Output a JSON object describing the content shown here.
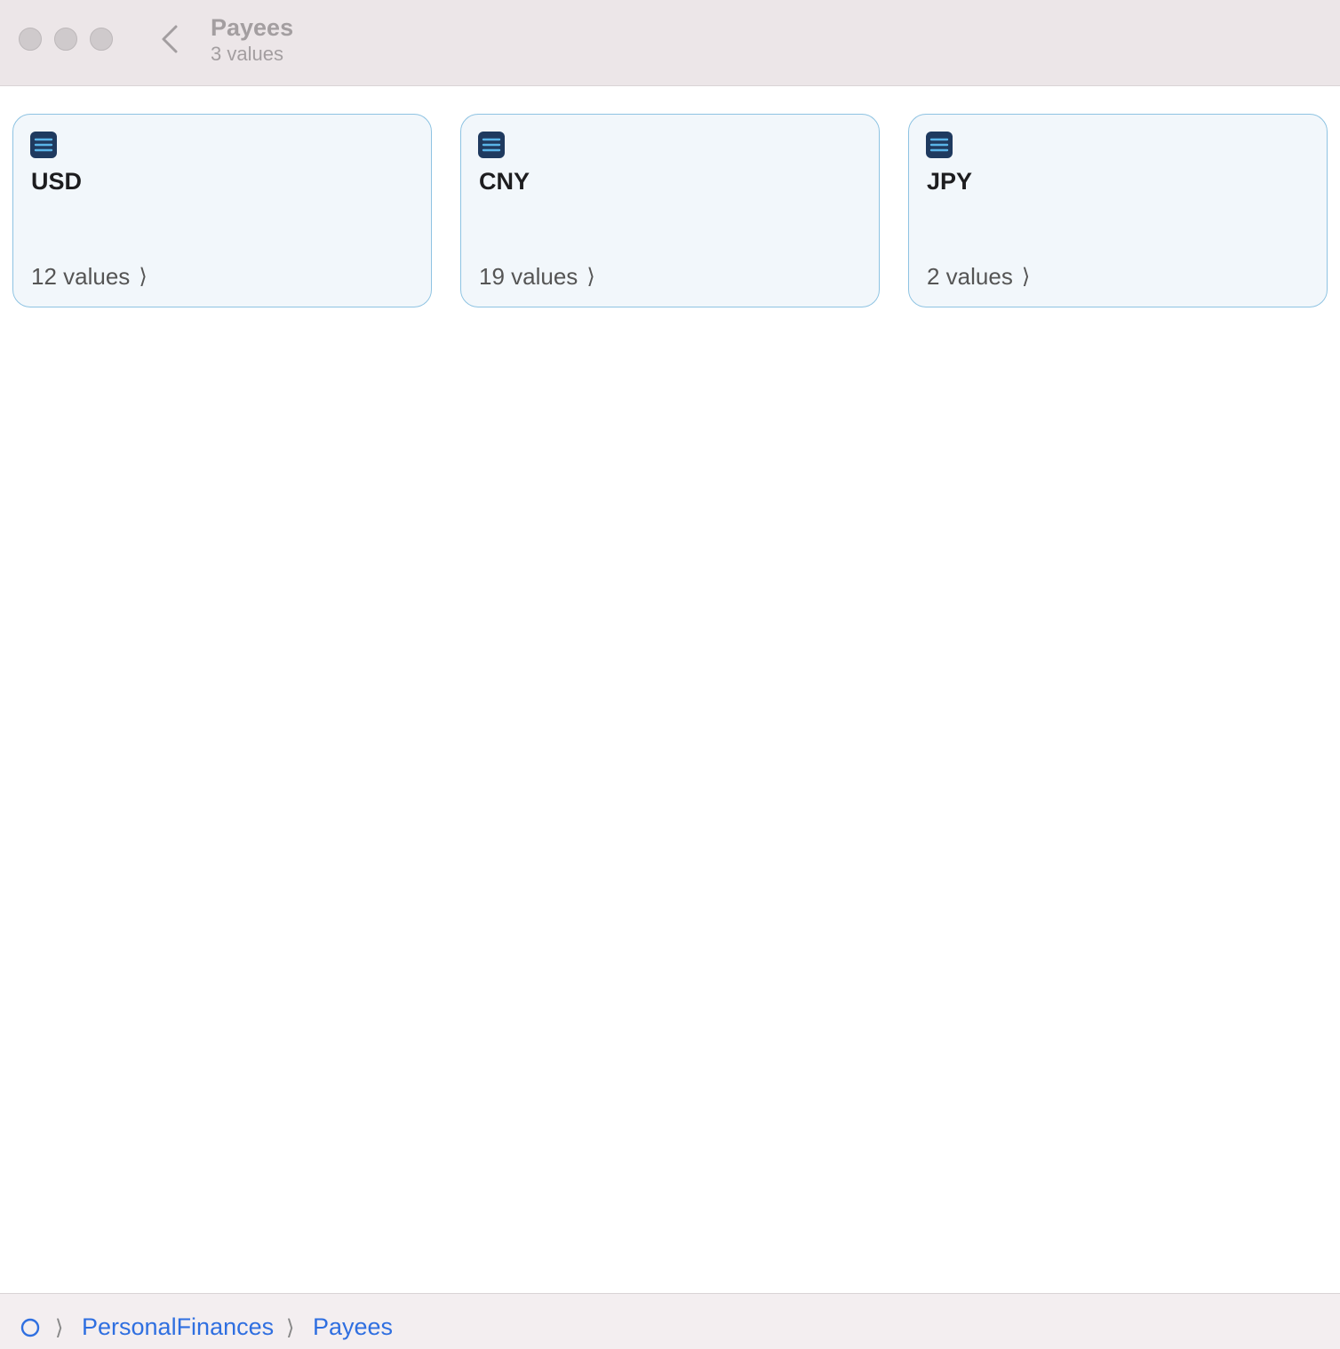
{
  "window": {
    "title": "Payees",
    "subtitle": "3 values"
  },
  "cards": [
    {
      "title": "USD",
      "footer": "12 values"
    },
    {
      "title": "CNY",
      "footer": "19 values"
    },
    {
      "title": "JPY",
      "footer": "2 values"
    }
  ],
  "breadcrumb": {
    "items": [
      "PersonalFinances",
      "Payees"
    ]
  },
  "colors": {
    "accent": "#2f6fe0",
    "card_border": "#8ec3e2",
    "card_bg": "#f2f7fb",
    "icon_dark": "#1f3a5f",
    "icon_lines": "#5ab4e8"
  }
}
